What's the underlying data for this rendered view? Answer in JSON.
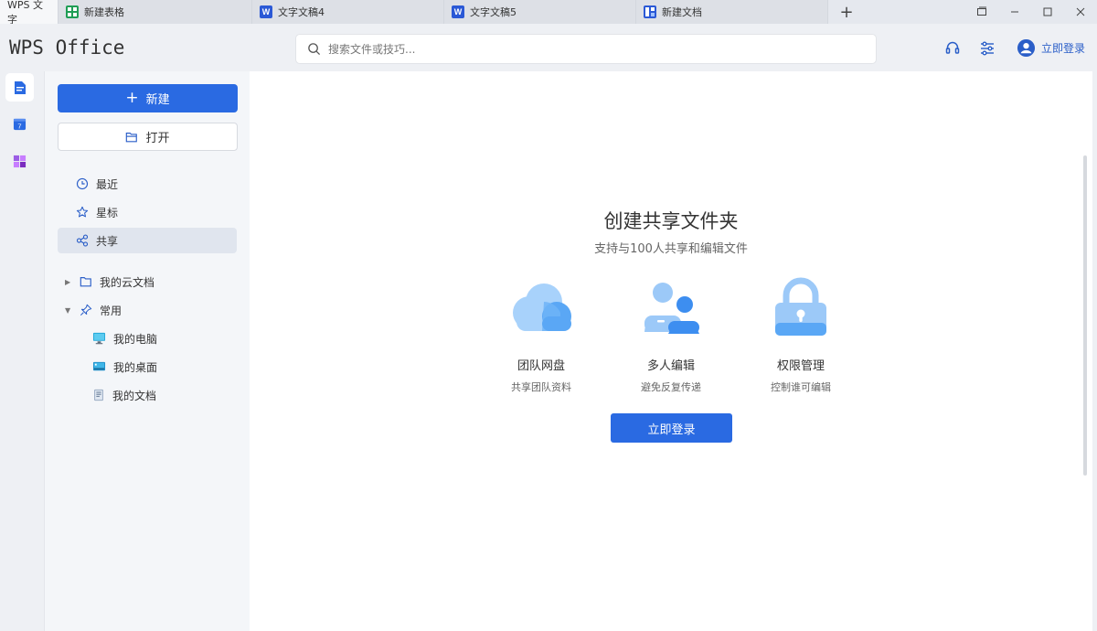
{
  "tabs": [
    {
      "label": "WPS 文字",
      "icon": "none"
    },
    {
      "label": "新建表格",
      "icon": "spreadsheet-icon"
    },
    {
      "label": "文字文稿4",
      "icon": "word-doc-icon"
    },
    {
      "label": "文字文稿5",
      "icon": "word-doc-icon"
    },
    {
      "label": "新建文档",
      "icon": "new-doc-icon"
    }
  ],
  "tab_add": "+",
  "header": {
    "logo": "WPS Office",
    "search_placeholder": "搜索文件或技巧...",
    "login_label": "立即登录"
  },
  "sidebar": {
    "new_label": "新建",
    "open_label": "打开",
    "nav": [
      {
        "label": "最近",
        "icon": "clock-icon"
      },
      {
        "label": "星标",
        "icon": "star-icon"
      },
      {
        "label": "共享",
        "icon": "share-icon"
      }
    ],
    "tree": [
      {
        "label": "我的云文档",
        "icon": "folder-icon"
      },
      {
        "label": "常用",
        "icon": "pin-icon"
      },
      {
        "label": "我的电脑",
        "icon": "computer-icon"
      },
      {
        "label": "我的桌面",
        "icon": "desktop-icon"
      },
      {
        "label": "我的文档",
        "icon": "document-icon"
      }
    ]
  },
  "main": {
    "title": "创建共享文件夹",
    "subtitle": "支持与100人共享和编辑文件",
    "features": [
      {
        "name": "团队网盘",
        "desc": "共享团队资料",
        "icon": "cloud-icon"
      },
      {
        "name": "多人编辑",
        "desc": "避免反复传递",
        "icon": "users-icon"
      },
      {
        "name": "权限管理",
        "desc": "控制谁可编辑",
        "icon": "lock-icon"
      }
    ],
    "login_button": "立即登录"
  },
  "colors": {
    "accent": "#2a6ae2",
    "link": "#2a5ec8",
    "sheet_green": "#1f9d55",
    "word_blue": "#2b59d6"
  }
}
